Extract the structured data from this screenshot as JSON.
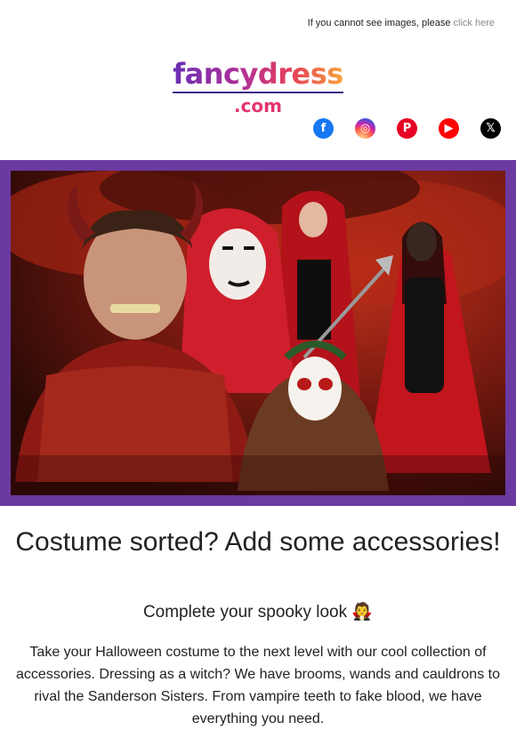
{
  "topbar": {
    "text": "If you cannot see images, please",
    "link": "click here"
  },
  "logo": {
    "main": "fancydress",
    "sub": ".com"
  },
  "social": [
    {
      "name": "facebook",
      "glyph": "f"
    },
    {
      "name": "instagram",
      "glyph": "◎"
    },
    {
      "name": "pinterest",
      "glyph": "P"
    },
    {
      "name": "youtube",
      "glyph": "▶"
    },
    {
      "name": "x",
      "glyph": "𝕏"
    }
  ],
  "hero": {
    "colors": {
      "frame": "#6b3aa0",
      "bg": "#7a1a10"
    }
  },
  "content": {
    "heading": "Costume sorted? Add some accessories!",
    "subheading": "Complete your spooky look 🧛",
    "paragraph": "Take your Halloween costume to the next level with our cool collection of accessories. Dressing as a witch? We have brooms, wands and cauldrons to rival the Sanderson Sisters. From vampire teeth to fake blood, we have everything you need."
  }
}
